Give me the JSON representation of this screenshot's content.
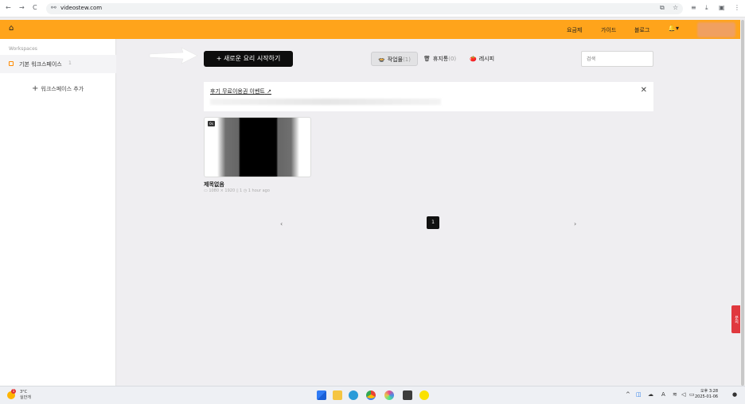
{
  "browser": {
    "url": "videostew.com",
    "nav_back": "←",
    "nav_forward": "→",
    "nav_reload": "C",
    "tune_icon": "⚯",
    "right_icons": [
      "⧉",
      "☆",
      "≡",
      "⤓",
      "▣",
      "⋮"
    ]
  },
  "header": {
    "home_icon": "⌂",
    "links": [
      "요금제",
      "가이드",
      "블로그"
    ],
    "bell_icon": "🔔",
    "bell_caret": "▾"
  },
  "sidebar": {
    "section_title": "Workspaces",
    "workspace_label": "기본 워크스페이스",
    "workspace_count": "1",
    "add_label": "워크스페이스 추가",
    "add_icon": "+"
  },
  "main": {
    "new_button": "+ 새로운 요리 시작하기",
    "tabs": [
      {
        "icon": "🍲",
        "label": "작업물",
        "count": "(1)"
      },
      {
        "icon": "🗑",
        "label": "휴지통",
        "count": "(0)"
      },
      {
        "icon": "🍅",
        "label": "레시피",
        "count": ""
      }
    ],
    "search_placeholder": "검색",
    "notice": {
      "text": "후기 무료이용권 이벤트",
      "ext_icon": "↗",
      "close_icon": "✕"
    },
    "project": {
      "badge": "0s",
      "title": "제목없음",
      "meta": "▭ 1080 × 1920  ▯ 1  ◷ 1 hour ago"
    },
    "pagination": {
      "prev": "‹",
      "current": "1",
      "next": "›"
    },
    "side_tab": "문의"
  },
  "taskbar": {
    "weather_temp": "3°C",
    "weather_desc": "실안개",
    "weather_alert": "1",
    "tray_chevron": "^",
    "tray_lang": "A",
    "clock_time": "오후 3:28",
    "clock_date": "2025-01-06"
  },
  "colors": {
    "header": "#ffa41b",
    "button": "#0d0d0d",
    "side_tab": "#e0383e"
  }
}
